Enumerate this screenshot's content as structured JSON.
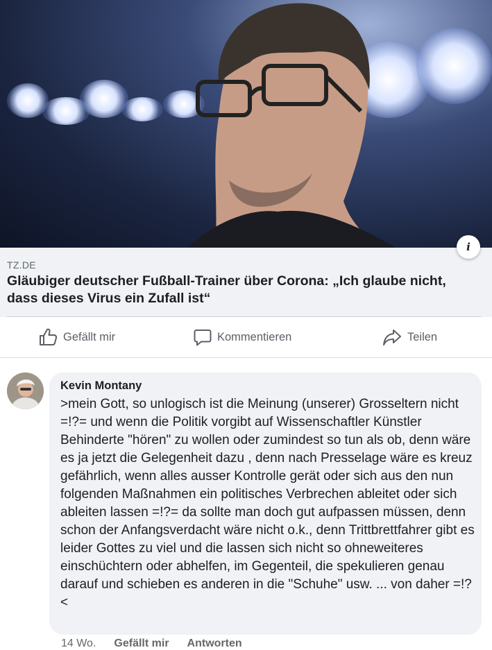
{
  "link_preview": {
    "source": "TZ.DE",
    "headline": "Gläubiger deutscher Fußball-Trainer über Corona: „Ich glaube nicht, dass dieses Virus ein Zufall ist“",
    "info_icon": "info-icon"
  },
  "actions": {
    "like_label": "Gefällt mir",
    "comment_label": "Kommentieren",
    "share_label": "Teilen"
  },
  "comment": {
    "author": "Kevin Montany",
    "text": ">mein Gott, so unlogisch ist die Meinung (unserer) Grosseltern nicht =!?= und wenn die Politik vorgibt auf Wissenschaftler Künstler Behinderte \"hören\" zu wollen oder zumindest so tun als ob, denn wäre es ja jetzt die Gelegenheit dazu , denn nach Presselage wäre es kreuz gefährlich, wenn alles ausser Kontrolle gerät oder sich aus den nun folgenden Maßnahmen ein  politisches Verbrechen ableitet oder sich ableiten lassen =!?= da sollte man doch gut aufpassen müssen, denn schon der Anfangsverdacht wäre nicht o.k., denn Trittbrettfahrer gibt es leider Gottes zu viel und die lassen sich nicht so ohneweiteres einschüchtern oder abhelfen, im Gegenteil, die spekulieren genau darauf und schieben es anderen in die \"Schuhe\" usw. ... von daher =!?<",
    "time": "14 Wo.",
    "like_label": "Gefällt mir",
    "reply_label": "Antworten"
  },
  "colors": {
    "card_bg": "#f0f2f5",
    "action_text": "#5b5f66",
    "meta_text": "#65676b"
  }
}
